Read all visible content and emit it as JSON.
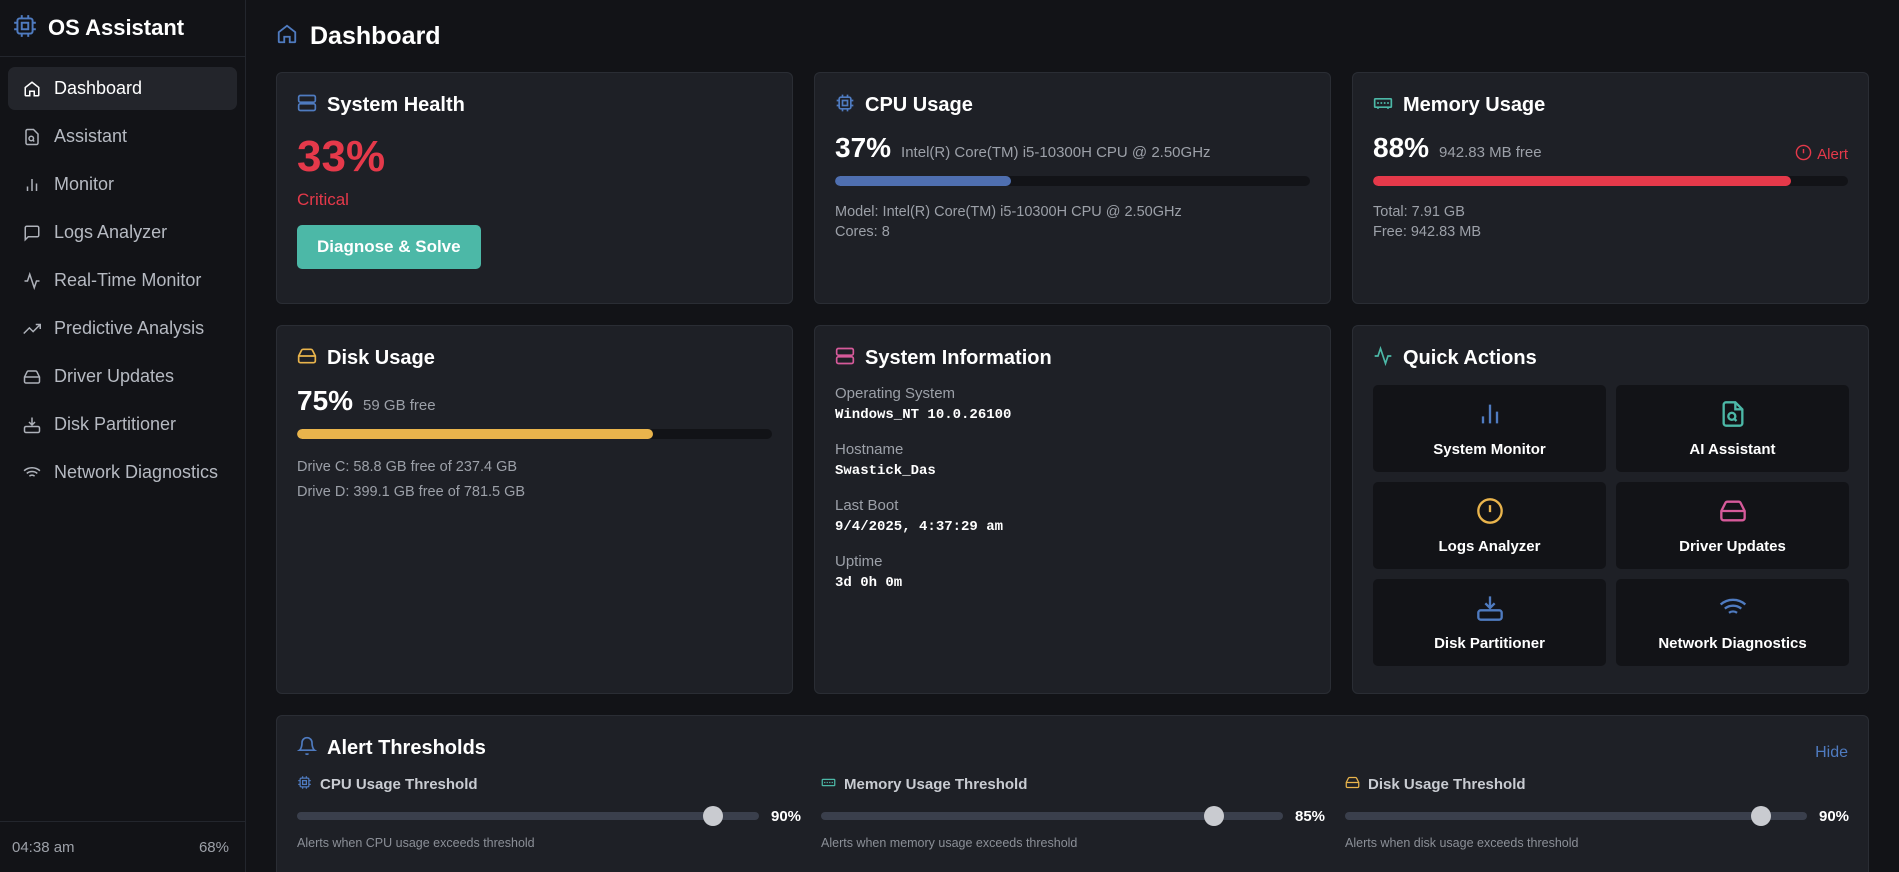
{
  "app": {
    "title": "OS Assistant"
  },
  "sidebar": {
    "items": [
      {
        "label": "Dashboard",
        "icon": "home-icon",
        "active": true
      },
      {
        "label": "Assistant",
        "icon": "document-search-icon"
      },
      {
        "label": "Monitor",
        "icon": "bar-chart-icon"
      },
      {
        "label": "Logs Analyzer",
        "icon": "message-icon"
      },
      {
        "label": "Real-Time Monitor",
        "icon": "activity-icon"
      },
      {
        "label": "Predictive Analysis",
        "icon": "trending-up-icon"
      },
      {
        "label": "Driver Updates",
        "icon": "hard-drive-icon"
      },
      {
        "label": "Disk Partitioner",
        "icon": "download-drive-icon"
      },
      {
        "label": "Network Diagnostics",
        "icon": "wifi-icon"
      }
    ],
    "footer": {
      "time": "04:38 am",
      "battery": "68%"
    }
  },
  "page": {
    "title": "Dashboard"
  },
  "health": {
    "title": "System Health",
    "value": "33%",
    "status": "Critical",
    "button": "Diagnose & Solve"
  },
  "cpu": {
    "title": "CPU Usage",
    "value": "37%",
    "percent": 37,
    "sub": "Intel(R) Core(TM) i5-10300H CPU @ 2.50GHz",
    "model": "Model: Intel(R) Core(TM) i5-10300H CPU @ 2.50GHz",
    "cores": "Cores: 8"
  },
  "memory": {
    "title": "Memory Usage",
    "value": "88%",
    "percent": 88,
    "sub": "942.83 MB free",
    "alert": "Alert",
    "total": "Total: 7.91 GB",
    "free": "Free: 942.83 MB"
  },
  "disk": {
    "title": "Disk Usage",
    "value": "75%",
    "percent": 75,
    "sub": "59 GB free",
    "drive_c": "Drive C: 58.8 GB free of 237.4 GB",
    "drive_d": "Drive D: 399.1 GB free of 781.5 GB"
  },
  "sysinfo": {
    "title": "System Information",
    "os_label": "Operating System",
    "os": "Windows_NT 10.0.26100",
    "host_label": "Hostname",
    "host": "Swastick_Das",
    "boot_label": "Last Boot",
    "boot": "9/4/2025, 4:37:29 am",
    "uptime_label": "Uptime",
    "uptime": "3d 0h 0m"
  },
  "quick": {
    "title": "Quick Actions",
    "actions": [
      {
        "label": "System Monitor",
        "icon": "bar-chart-icon"
      },
      {
        "label": "AI Assistant",
        "icon": "document-search-icon"
      },
      {
        "label": "Logs Analyzer",
        "icon": "alert-circle-icon"
      },
      {
        "label": "Driver Updates",
        "icon": "hard-drive-icon"
      },
      {
        "label": "Disk Partitioner",
        "icon": "download-drive-icon"
      },
      {
        "label": "Network Diagnostics",
        "icon": "wifi-icon"
      }
    ]
  },
  "thresholds": {
    "title": "Alert Thresholds",
    "hide": "Hide",
    "items": [
      {
        "label": "CPU Usage Threshold",
        "value": "90%",
        "level": 90,
        "note": "Alerts when CPU usage exceeds threshold"
      },
      {
        "label": "Memory Usage Threshold",
        "value": "85%",
        "level": 85,
        "note": "Alerts when memory usage exceeds threshold"
      },
      {
        "label": "Disk Usage Threshold",
        "value": "90%",
        "level": 90,
        "note": "Alerts when disk usage exceeds threshold"
      }
    ]
  },
  "colors": {
    "critical": "#e5394a",
    "cpu_bar": "#4f6fb0",
    "memory_bar": "#e5394a",
    "disk_bar": "#e9b44c",
    "teal": "#4cb8a7",
    "link": "#4f7bc0"
  }
}
